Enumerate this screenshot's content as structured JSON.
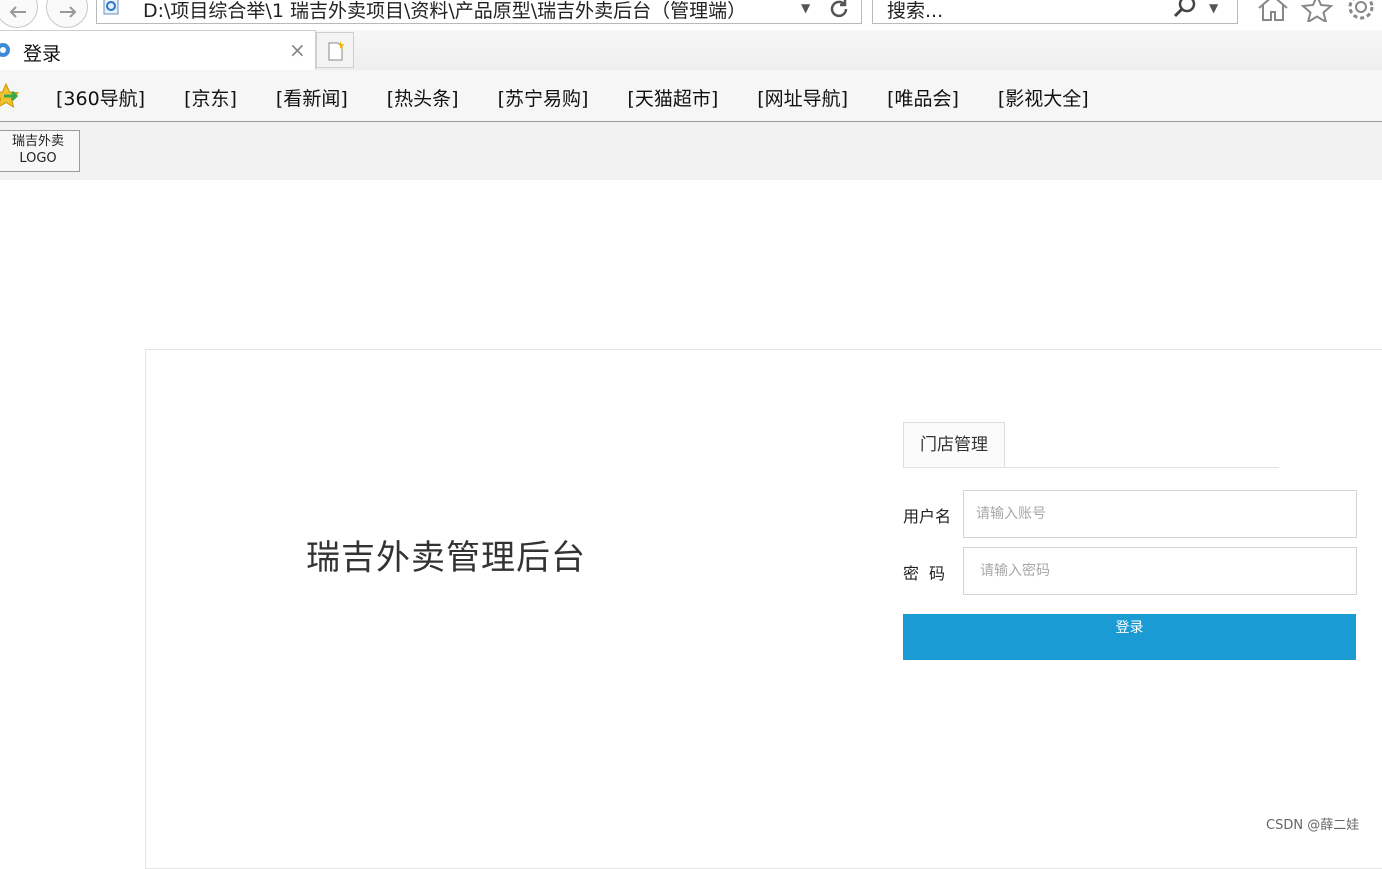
{
  "browser": {
    "address": "D:\\项目综合举\\1 瑞吉外卖项目\\资料\\产品原型\\瑞吉外卖后台（管理端）",
    "search_placeholder": "搜索...",
    "tab_title": "登录",
    "tab_close": "×",
    "favorites": [
      "[360导航]",
      "[京东]",
      "[看新闻]",
      "[热头条]",
      "[苏宁易购]",
      "[天猫超市]",
      "[网址导航]",
      "[唯品会]",
      "[影视大全]"
    ]
  },
  "header": {
    "logo_line1": "瑞吉外卖",
    "logo_line2": "LOGO"
  },
  "login": {
    "system_title": "瑞吉外卖管理后台",
    "tab_label": "门店管理",
    "username_label": "用户名",
    "username_placeholder": "请输入账号",
    "password_label": "密码",
    "password_placeholder": "请输入密码",
    "submit_label": "登录"
  },
  "watermark": "CSDN @薛二娃",
  "colors": {
    "primary_button": "#1a9bd3",
    "header_bg": "#f2f2f2"
  }
}
